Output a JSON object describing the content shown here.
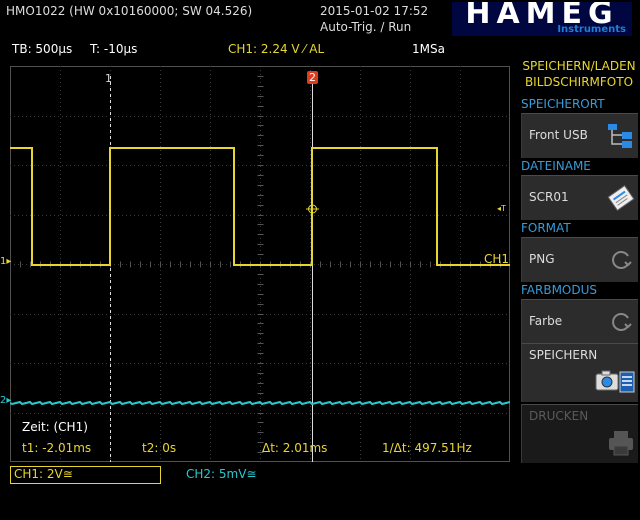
{
  "header": {
    "device": "HMO1022 (HW 0x10160000; SW 04.526)",
    "datetime": "2015-01-02 17:52",
    "trigger_status": "Auto-Trig. / Run",
    "logo": "HAMEG",
    "logo_sub": "Instruments"
  },
  "infobar": {
    "timebase": "TB: 500µs",
    "trigger_time": "T: -10µs",
    "ch1_trigger": "CH1: 2.24 V ⁄ AL",
    "sample_rate": "1MSa"
  },
  "plot": {
    "cursor1_label": "1",
    "cursor2_label": "2",
    "ch1_label": "CH1",
    "ch1_marker": "1",
    "ch2_marker": "2",
    "trigger_marker": "◂T",
    "time_label": "Zeit: (CH1)",
    "t1": "t1: -2.01ms",
    "t2": "t2: 0s",
    "dt": "Δt: 2.01ms",
    "inv_dt": "1/Δt: 497.51Hz"
  },
  "colors": {
    "ch1": "#e8d630",
    "ch2": "#28c8d0",
    "grid": "#3a3a3a",
    "menu_heading": "#3a9ad9",
    "cursor2": "#e23a1e"
  },
  "sidebar": {
    "title_line1": "SPEICHERN/LADEN",
    "title_line2": "BILDSCHIRMFOTO",
    "speicherort_label": "SPEICHERORT",
    "speicherort_value": "Front USB",
    "dateiname_label": "DATEINAME",
    "dateiname_value": "SCR01",
    "format_label": "FORMAT",
    "format_value": "PNG",
    "farbmodus_label": "FARBMODUS",
    "farbmodus_value": "Farbe",
    "speichern_label": "SPEICHERN",
    "drucken_label": "DRUCKEN"
  },
  "bottom": {
    "ch1_scale": "CH1: 2V≅",
    "ch2_scale": "CH2: 5mV≅"
  },
  "icons": [
    "folder-tree-icon",
    "rename-icon",
    "refresh-icon",
    "camera-icon",
    "printer-icon"
  ]
}
